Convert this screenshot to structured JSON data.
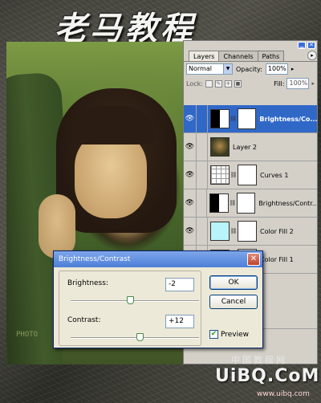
{
  "banner": {
    "title": "老马教程"
  },
  "photo": {
    "watermark": "PHOTO"
  },
  "layers_panel": {
    "tabs": [
      {
        "label": "Layers",
        "active": true
      },
      {
        "label": "Channels",
        "active": false
      },
      {
        "label": "Paths",
        "active": false
      }
    ],
    "blend_mode": "Normal",
    "opacity_label": "Opacity:",
    "opacity_value": "100%",
    "lock_label": "Lock:",
    "fill_label": "Fill:",
    "fill_value": "100%",
    "layers": [
      {
        "name": "Brightness/Co...",
        "thumb": "brightness-contrast",
        "mask": true,
        "selected": true
      },
      {
        "name": "Layer 2",
        "thumb": "photo",
        "mask": false,
        "selected": false
      },
      {
        "name": "Curves 1",
        "thumb": "curves",
        "mask": true,
        "selected": false
      },
      {
        "name": "Brightness/Contr...",
        "thumb": "brightness-contrast",
        "mask": true,
        "selected": false
      },
      {
        "name": "Color Fill 2",
        "thumb": "color",
        "color": "#b8f4fa",
        "mask": true,
        "selected": false
      },
      {
        "name": "Color Fill 1",
        "thumb": "color",
        "color": "#0c1a4e",
        "mask": true,
        "selected": false
      }
    ]
  },
  "dialog": {
    "title": "Brightness/Contrast",
    "brightness_label": "Brightness:",
    "brightness_value": "-2",
    "contrast_label": "Contrast:",
    "contrast_value": "+12",
    "ok_label": "OK",
    "cancel_label": "Cancel",
    "preview_label": "Preview",
    "preview_checked": true
  },
  "footer": {
    "logo": "UiBQ.CoM",
    "chinese": "中国教程网",
    "url": "www.uibq.com"
  }
}
